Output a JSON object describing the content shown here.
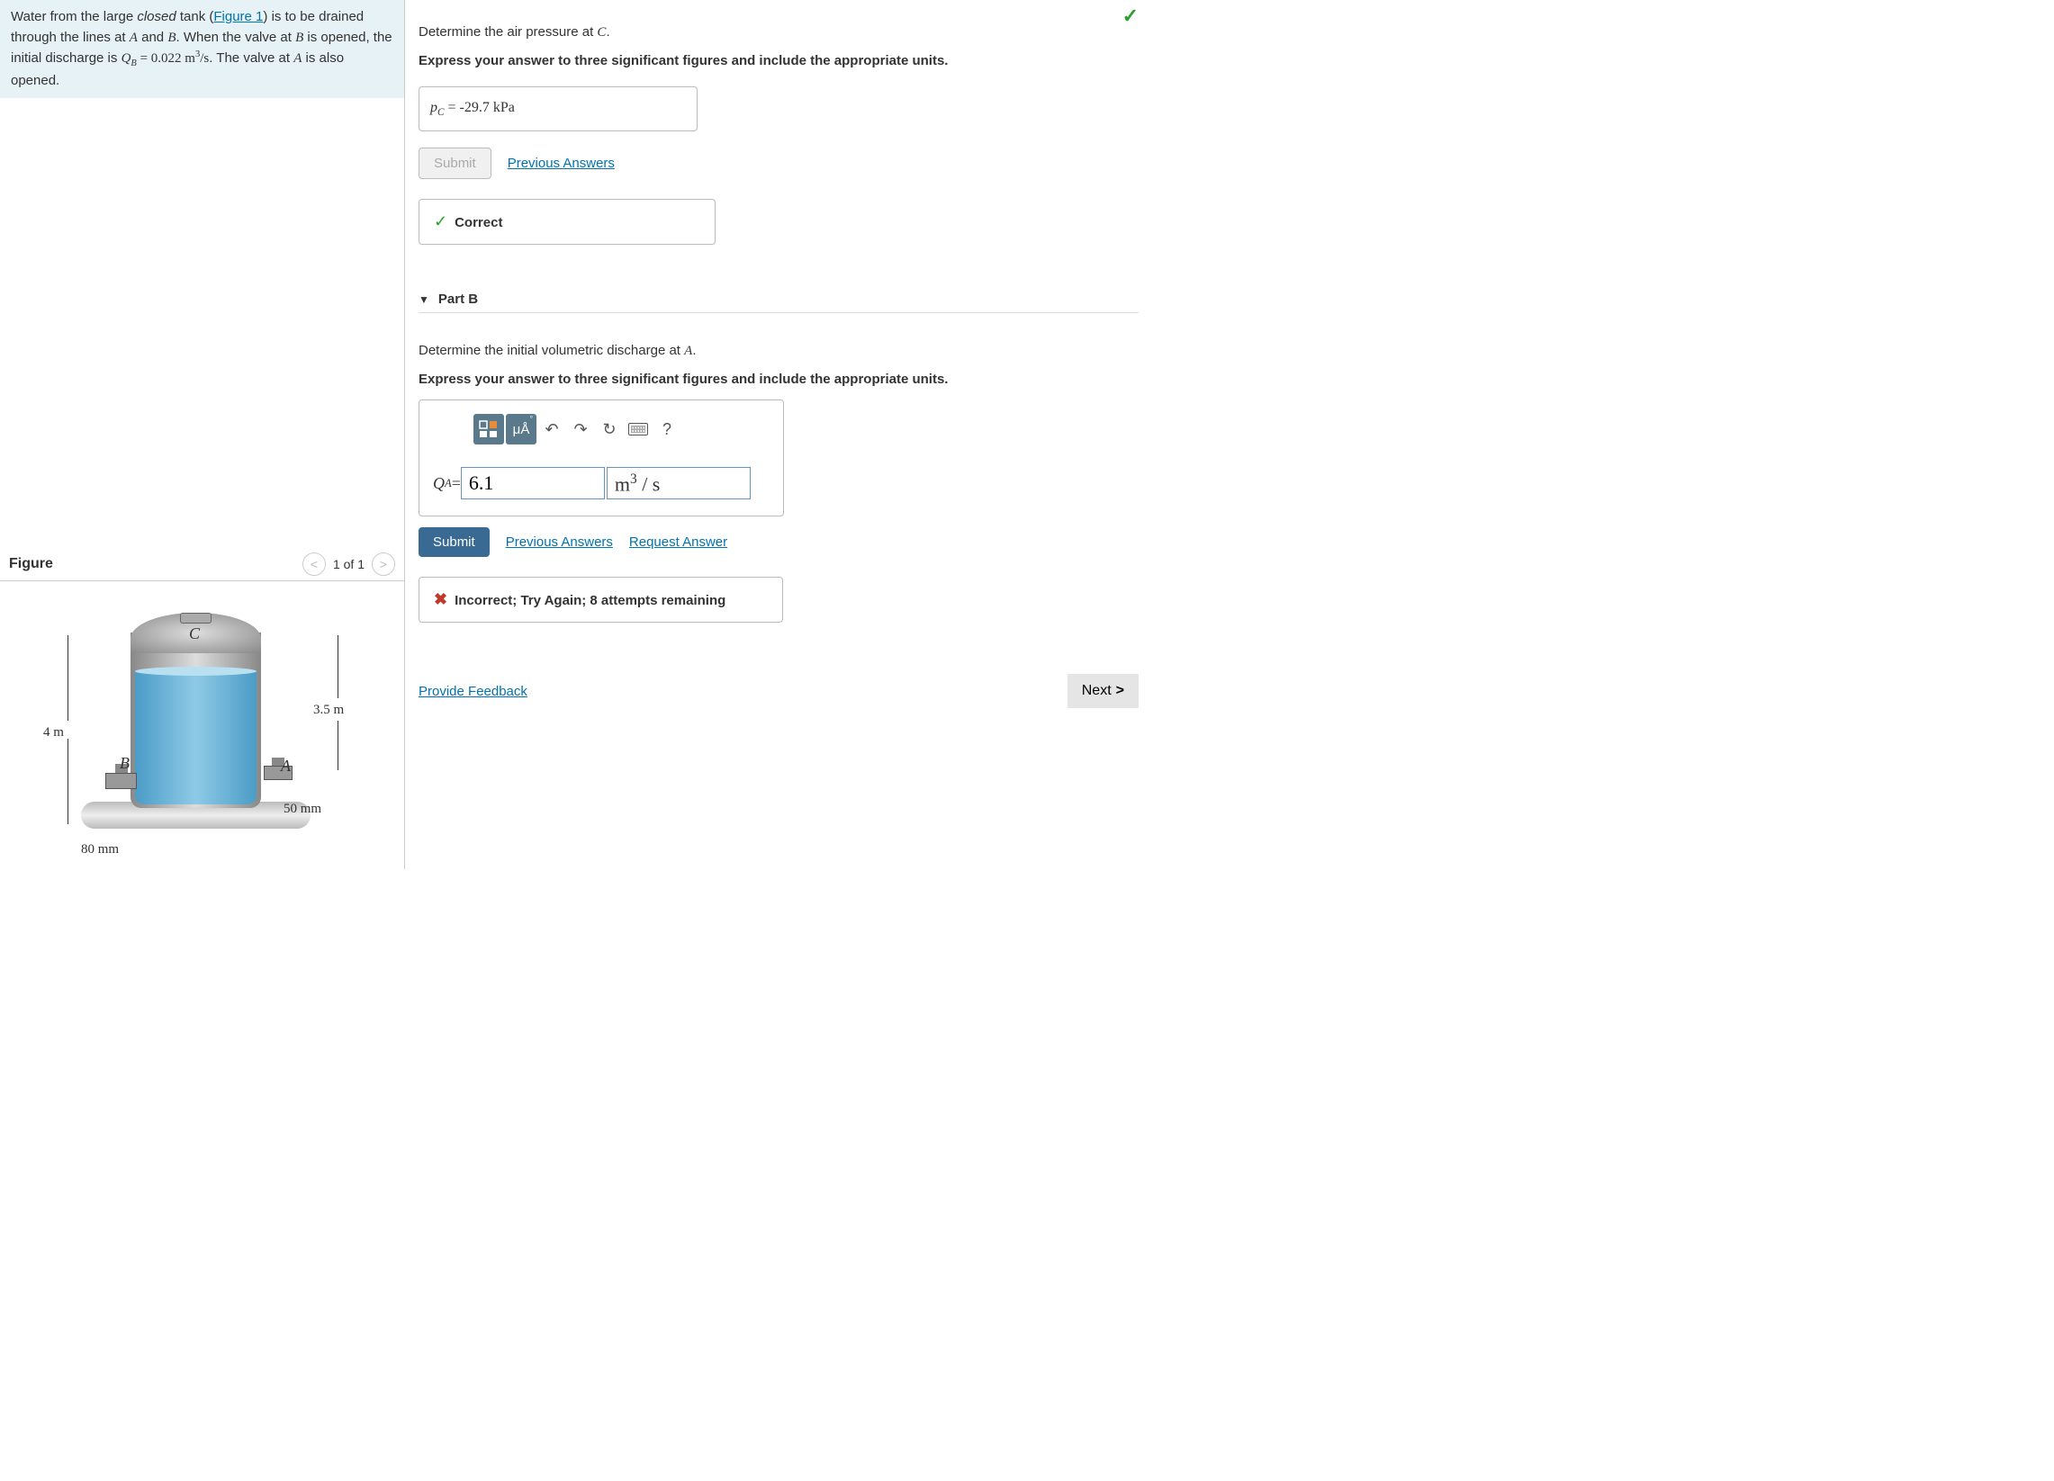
{
  "problem": {
    "pre": "Water from the large ",
    "closed": "closed",
    "mid1": " tank (",
    "figlink": "Figure 1",
    "mid2": ") is to be drained through the lines at ",
    "A": "A",
    "mid3": " and ",
    "B": "B",
    "mid4": ". When the valve at ",
    "mid5": " is opened, the initial discharge is ",
    "QB": "Q",
    "QBsub": "B",
    "eq": " = 0.022 ",
    "unit_m": "m",
    "unit_sup": "3",
    "unit_rest": "/s",
    "mid6": ". The valve at ",
    "end": " is also opened."
  },
  "figure": {
    "title": "Figure",
    "nav": "1 of 1",
    "C": "C",
    "B": "B",
    "A": "A",
    "dim1": "4 m",
    "dim2": "3.5 m",
    "dim3": "50 mm",
    "dim4": "80 mm"
  },
  "partA": {
    "q1a": "Determine the air pressure at ",
    "q1b": "C",
    "q1c": ".",
    "q2": "Express your answer to three significant figures and include the appropriate units.",
    "ans_label_p": "p",
    "ans_label_sub": "C",
    "ans_eq": " = ",
    "ans_val": "-29.7 kPa",
    "submit": "Submit",
    "prev": "Previous Answers",
    "correct": "Correct"
  },
  "partB": {
    "header": "Part B",
    "q1a": "Determine the initial volumetric discharge at ",
    "q1b": "A",
    "q1c": ".",
    "q2": "Express your answer to three significant figures and include the appropriate units.",
    "tool_units": "μÅ",
    "ans_label_Q": "Q",
    "ans_label_sub": "A",
    "ans_eq": " = ",
    "ans_val": "6.1",
    "unit_val_m": "m",
    "unit_val_sup": "3",
    "unit_val_rest": " / s",
    "submit": "Submit",
    "prev": "Previous Answers",
    "req": "Request Answer",
    "incorrect": "Incorrect; Try Again; 8 attempts remaining"
  },
  "footer": {
    "feedback": "Provide Feedback",
    "next": "Next"
  }
}
